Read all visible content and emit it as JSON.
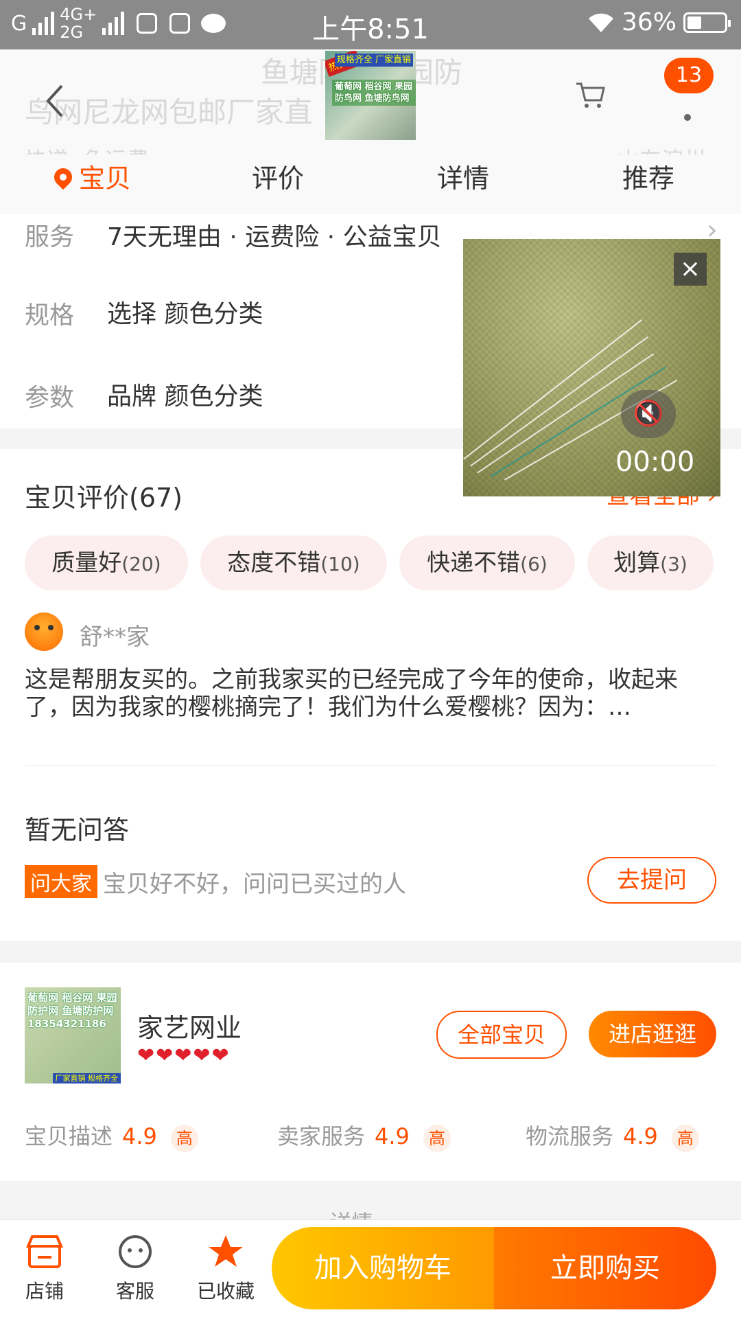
{
  "status_bar": {
    "network_1": "G",
    "network_2_top": "4G+",
    "network_2_bottom": "2G",
    "time": "上午8:51",
    "battery": "36%"
  },
  "header": {
    "ghost_title_1": "鱼塘防护果园防",
    "ghost_title_2": "鸟网尼龙网包邮厂家直",
    "ghost_shipping": "快递: 免运费",
    "ghost_location": "山东滨州",
    "thumbnail": {
      "badge_hot": "热卖中",
      "badge_spec": "规格齐全 厂家直销",
      "lines": "葡萄网 稻谷网 果园防鸟网 鱼塘防鸟网"
    },
    "cart_badge": "13"
  },
  "tabs": [
    {
      "label": "宝贝"
    },
    {
      "label": "评价"
    },
    {
      "label": "详情"
    },
    {
      "label": "推荐"
    }
  ],
  "service": {
    "label": "服务",
    "value": "7天无理由 · 运费险 · 公益宝贝"
  },
  "spec": {
    "label": "规格",
    "value": "选择 颜色分类"
  },
  "params": {
    "label": "参数",
    "value": "品牌 颜色分类"
  },
  "video": {
    "time": "00:00"
  },
  "reviews": {
    "title": "宝贝评价(67)",
    "see_all": "查看全部 ›",
    "chips": [
      {
        "label": "质量好",
        "count": "(20)"
      },
      {
        "label": "态度不错",
        "count": "(10)"
      },
      {
        "label": "快递不错",
        "count": "(6)"
      },
      {
        "label": "划算",
        "count": "(3)"
      }
    ],
    "reviewer": "舒**家",
    "text": "这是帮朋友买的。之前我家买的已经完成了今年的使命，收起来了，因为我家的樱桃摘完了！我们为什么爱樱桃？因为：…"
  },
  "qa": {
    "title": "暂无问答",
    "tag": "问大家",
    "prompt": "宝贝好不好，问问已买过的人",
    "button": "去提问"
  },
  "shop": {
    "logo_lines": "葡萄网 稻谷网 果园防护网 鱼塘防护网 18354321186",
    "logo_bar": "厂家直销 规格齐全",
    "name": "家艺网业",
    "hearts": "❤❤❤❤❤",
    "all_items": "全部宝贝",
    "visit": "进店逛逛",
    "scores": [
      {
        "label": "宝贝描述",
        "value": "4.9",
        "level": "高"
      },
      {
        "label": "卖家服务",
        "value": "4.9",
        "level": "高"
      },
      {
        "label": "物流服务",
        "value": "4.9",
        "level": "高"
      }
    ]
  },
  "details_peek": "详情",
  "bottom_bar": {
    "shop": "店铺",
    "service": "客服",
    "favorited": "已收藏",
    "add_to_cart": "加入购物车",
    "buy_now": "立即购买"
  },
  "colors": {
    "accent": "#ff5000",
    "cart_button": "#ffb300",
    "chip_bg": "#fceeee"
  }
}
